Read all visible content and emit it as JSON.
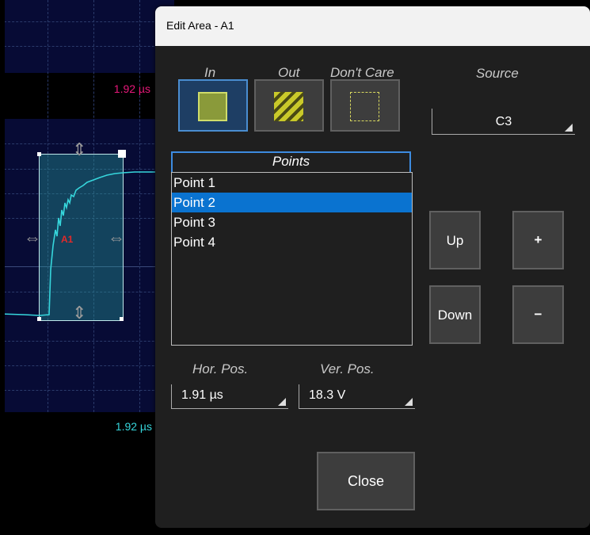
{
  "scope": {
    "time_top": "1.92 µs",
    "time_bottom": "1.92 µs",
    "area_label": "A1"
  },
  "dialog": {
    "title": "Edit Area - A1",
    "condition_types": [
      {
        "label": "In",
        "selected": true
      },
      {
        "label": "Out",
        "selected": false
      },
      {
        "label": "Don't Care",
        "selected": false
      }
    ],
    "source": {
      "label": "Source",
      "value": "C3"
    },
    "points": {
      "header": "Points",
      "items": [
        "Point 1",
        "Point 2",
        "Point 3",
        "Point 4"
      ],
      "selected_index": 1
    },
    "buttons": {
      "up": "Up",
      "down": "Down",
      "plus": "+",
      "minus": "−",
      "close": "Close"
    },
    "hor_pos": {
      "label": "Hor. Pos.",
      "value": "1.91 µs"
    },
    "ver_pos": {
      "label": "Ver. Pos.",
      "value": "18.3 V"
    }
  },
  "colors": {
    "accent_blue": "#0a73d0",
    "trace_cyan": "#36d6dc",
    "time_magenta": "#e8187a",
    "area_label_red": "#e22a2a",
    "in_swatch": "#8a9a3a"
  }
}
